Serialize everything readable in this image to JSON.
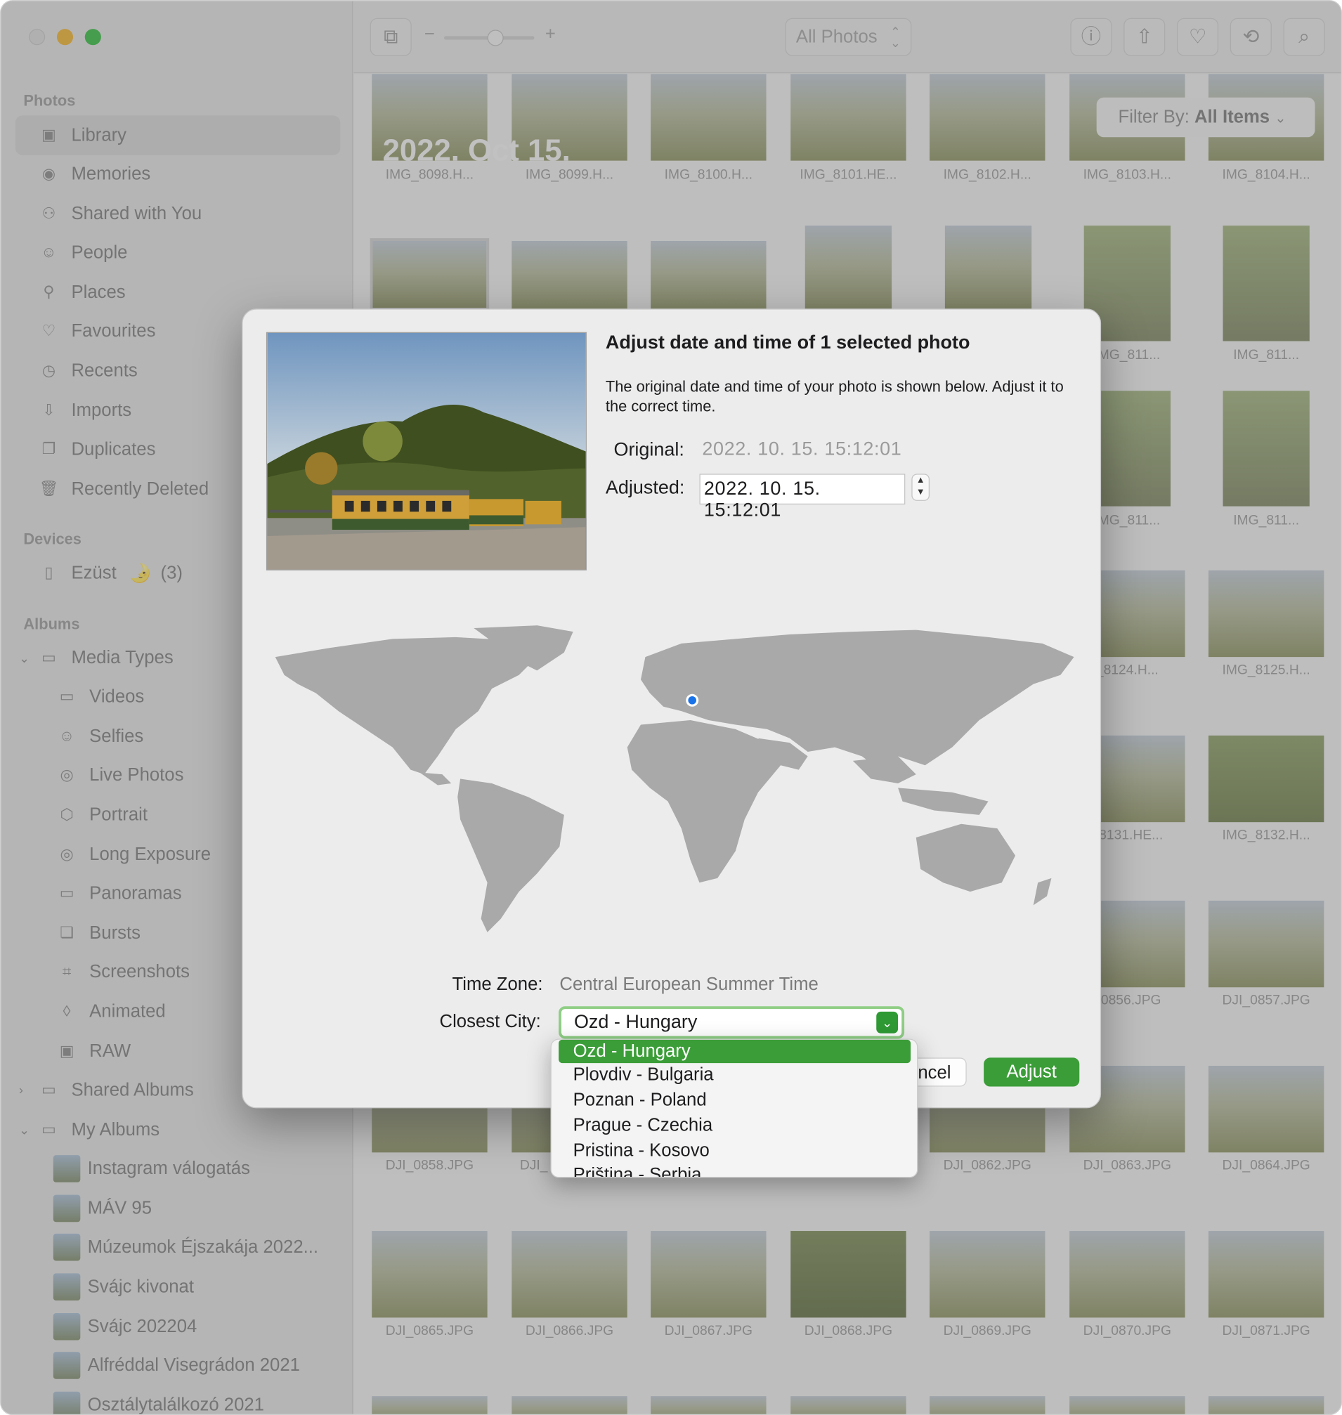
{
  "sidebar": {
    "sections": {
      "photos": "Photos",
      "devices": "Devices",
      "albums": "Albums"
    },
    "photos_items": [
      {
        "label": "Library",
        "icon": "library-icon"
      },
      {
        "label": "Memories",
        "icon": "memories-icon"
      },
      {
        "label": "Shared with You",
        "icon": "shared-with-you-icon"
      },
      {
        "label": "People",
        "icon": "people-icon"
      },
      {
        "label": "Places",
        "icon": "places-icon"
      },
      {
        "label": "Favourites",
        "icon": "heart-icon"
      },
      {
        "label": "Recents",
        "icon": "clock-icon"
      },
      {
        "label": "Imports",
        "icon": "import-icon"
      },
      {
        "label": "Duplicates",
        "icon": "duplicates-icon"
      },
      {
        "label": "Recently Deleted",
        "icon": "trash-icon"
      }
    ],
    "device": {
      "name": "Ezüst",
      "emoji": "🌛",
      "count": "(3)"
    },
    "media_types_label": "Media Types",
    "media_types": [
      "Videos",
      "Selfies",
      "Live Photos",
      "Portrait",
      "Long Exposure",
      "Panoramas",
      "Bursts",
      "Screenshots",
      "Animated",
      "RAW"
    ],
    "shared_albums_label": "Shared Albums",
    "my_albums_label": "My Albums",
    "my_albums": [
      "Instagram válogatás",
      "MÁV 95",
      "Múzeumok Éjszakája 2022...",
      "Svájc kivonat",
      "Svájc 202204",
      "Alfréddal Visegrádon 2021",
      "Osztálytalálkozó 2021"
    ]
  },
  "toolbar": {
    "zoom_minus": "−",
    "zoom_plus": "+",
    "view_select": "All Photos",
    "icons": [
      "info-icon",
      "share-icon",
      "heart-icon",
      "rotate-icon",
      "search-icon"
    ]
  },
  "grid": {
    "date_header": "2022. Oct 15.",
    "filter_prefix": "Filter By:",
    "filter_value": "All Items",
    "row1": [
      "IMG_8098.H...",
      "IMG_8099.H...",
      "IMG_8100.H...",
      "IMG_8101.HE...",
      "IMG_8102.H...",
      "IMG_8103.H...",
      "IMG_8104.H..."
    ],
    "right_caps": [
      [
        "IMG_811...",
        "IMG_811..."
      ],
      [
        "IMG_811...",
        "IMG_811..."
      ],
      [
        "_8124.H...",
        "IMG_8125.H..."
      ],
      [
        "_8131.HE...",
        "IMG_8132.H..."
      ],
      [
        "_0856.JPG",
        "DJI_0857.JPG"
      ]
    ],
    "row_dji1": [
      "DJI_0858.JPG",
      "DJI_",
      "",
      "",
      "DJI_0862.JPG",
      "DJI_0863.JPG",
      "DJI_0864.JPG"
    ],
    "row_dji2": [
      "DJI_0865.JPG",
      "DJI_0866.JPG",
      "DJI_0867.JPG",
      "DJI_0868.JPG",
      "DJI_0869.JPG",
      "DJI_0870.JPG",
      "DJI_0871.JPG"
    ]
  },
  "dialog": {
    "title": "Adjust date and time of 1 selected photo",
    "description": "The original date and time of your photo is shown below. Adjust it to the correct time.",
    "original_label": "Original:",
    "original_value": "2022. 10. 15. 15:12:01",
    "adjusted_label": "Adjusted:",
    "adjusted_value": "2022. 10. 15. 15:12:01",
    "timezone_label": "Time Zone:",
    "timezone_value": "Central European Summer Time",
    "city_label": "Closest City:",
    "city_value": "Ozd - Hungary",
    "cancel_label": "ncel",
    "adjust_label": "Adjust",
    "accent_color": "#3b9d38"
  },
  "city_menu": {
    "options": [
      "Ozd - Hungary",
      "Plovdiv - Bulgaria",
      "Poznan - Poland",
      "Prague - Czechia",
      "Pristina - Kosovo",
      "Priština - Serbia"
    ],
    "selected_index": 0
  }
}
